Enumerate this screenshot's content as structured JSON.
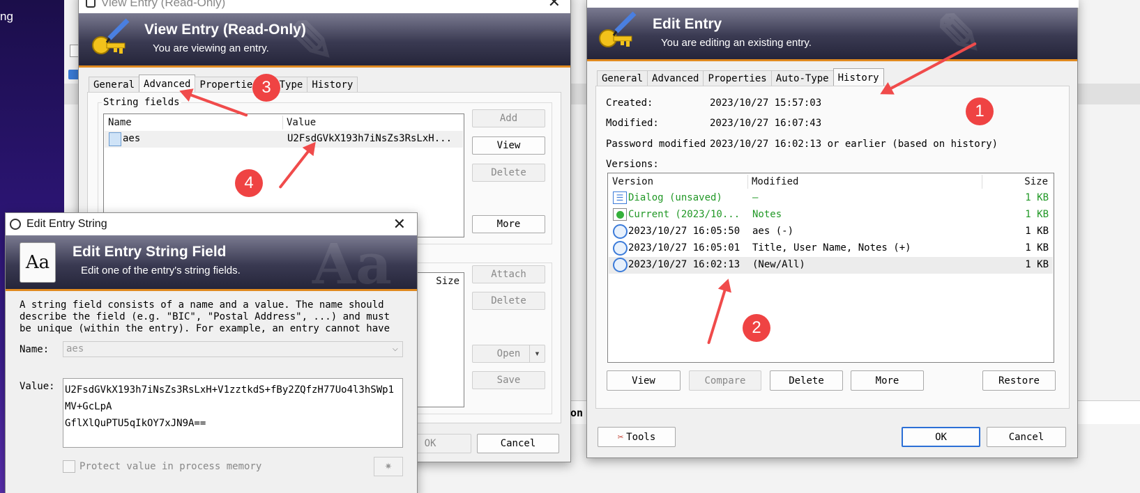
{
  "desktop": {
    "text": "ng"
  },
  "view_window": {
    "titlebar_title": "View Entry (Read-Only)",
    "banner_title": "View Entry (Read-Only)",
    "banner_subtitle": "You are viewing an entry.",
    "tabs": [
      "General",
      "Advanced",
      "Propertie",
      "to-Type",
      "History"
    ],
    "string_fields_label": "String fields",
    "columns": {
      "name": "Name",
      "value": "Value"
    },
    "row": {
      "name": "aes",
      "value": "U2FsdGVkX193h7iNsZs3RsLxH..."
    },
    "buttons": {
      "add": "Add",
      "view": "View",
      "delete": "Delete",
      "more": "More"
    },
    "attach_size_header": "Size",
    "attach_buttons": {
      "attach": "Attach",
      "delete": "Delete",
      "open": "Open",
      "save": "Save"
    },
    "ok": "OK",
    "cancel": "Cancel",
    "bg_text": "on T"
  },
  "edit_window": {
    "banner_title": "Edit Entry",
    "banner_subtitle": "You are editing an existing entry.",
    "tabs": [
      "General",
      "Advanced",
      "Properties",
      "Auto-Type",
      "History"
    ],
    "created_label": "Created:",
    "created_value": "2023/10/27 15:57:03",
    "modified_label": "Modified:",
    "modified_value": "2023/10/27 16:07:43",
    "pw_modified_label": "Password modified",
    "pw_modified_value": "2023/10/27 16:02:13 or earlier (based on history)",
    "versions_label": "Versions:",
    "columns": {
      "version": "Version",
      "modified": "Modified",
      "size": "Size"
    },
    "rows": [
      {
        "version": "Dialog (unsaved)",
        "modified": "—",
        "size": "1 KB",
        "icon": "list-icon",
        "color": "green"
      },
      {
        "version": "Current (2023/10...",
        "modified": "Notes",
        "size": "1 KB",
        "icon": "current-icon",
        "color": "green"
      },
      {
        "version": "2023/10/27 16:05:50",
        "modified": "aes (-)",
        "size": "1 KB",
        "icon": "clock-icon",
        "color": "black"
      },
      {
        "version": "2023/10/27 16:05:01",
        "modified": "Title, User Name, Notes (+)",
        "size": "1 KB",
        "icon": "clock-icon",
        "color": "black"
      },
      {
        "version": "2023/10/27 16:02:13",
        "modified": "(New/All)",
        "size": "1 KB",
        "icon": "clock-icon",
        "color": "black"
      }
    ],
    "buttons": {
      "view": "View",
      "compare": "Compare",
      "delete": "Delete",
      "more": "More",
      "restore": "Restore"
    },
    "tools": "Tools",
    "ok": "OK",
    "cancel": "Cancel"
  },
  "string_window": {
    "titlebar_title": "Edit Entry String",
    "banner_title": "Edit Entry String Field",
    "banner_subtitle": "Edit one of the entry's string fields.",
    "aa_icon_text": "Aa",
    "description": "A string field consists of a name and a value. The name should describe the field (e.g. \"BIC\", \"Postal Address\", ...) and must be unique (within the entry). For example, an entry cannot have",
    "name_label": "Name:",
    "name_value": "aes",
    "value_label": "Value:",
    "value_lines": [
      "U2FsdGVkX193h7iNsZs3RsLxH+V1zztkdS+fBy2ZQfzH77Uo4l3hSWp1",
      "MV+GcLpA",
      "GflXlQuPTU5qIkOY7xJN9A=="
    ],
    "protect_label": "Protect value in process memory"
  },
  "annotations": [
    "1",
    "2",
    "3",
    "4"
  ],
  "colors": {
    "accent": "#e08a20",
    "annotation": "#ef4343",
    "green_text": "#219826",
    "default_button_border": "#2b6fd6"
  }
}
